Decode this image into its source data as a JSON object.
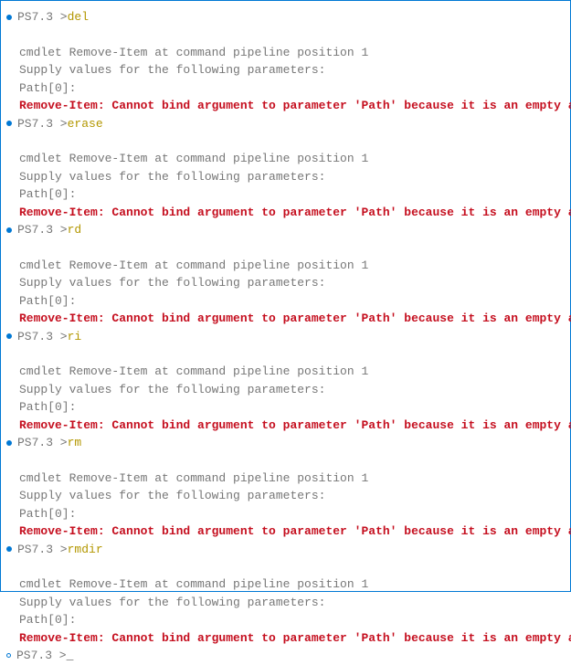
{
  "prompt_text": "PS7.3 >",
  "output_line1": "cmdlet Remove-Item at command pipeline position 1",
  "output_line2": "Supply values for the following parameters:",
  "output_line3": "Path[0]:",
  "error_text": "Remove-Item: Cannot bind argument to parameter 'Path' because it is an empty array.",
  "cursor": "_",
  "blocks": [
    {
      "cmd": "del"
    },
    {
      "cmd": "erase"
    },
    {
      "cmd": "rd"
    },
    {
      "cmd": "ri"
    },
    {
      "cmd": "rm"
    },
    {
      "cmd": "rmdir"
    }
  ]
}
